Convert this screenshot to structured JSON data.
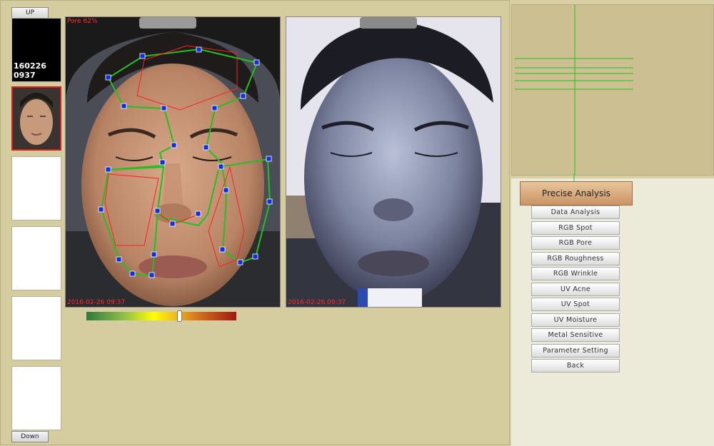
{
  "thumbnails": {
    "up_label": "UP",
    "down_label": "Down",
    "first_id_line1": "160226",
    "first_id_line2": "0937"
  },
  "photos": {
    "left_overlay_label": "Pore 62%",
    "left_timestamp": "2016-02-26 09:37",
    "right_timestamp": "2016-02-26 09:37"
  },
  "pore_scale": {
    "level": 0.62,
    "colors": [
      "#2f7a3c",
      "#ffff00",
      "#a01810"
    ]
  },
  "menu": {
    "header": "Precise Analysis",
    "items": [
      "Data Analysis",
      "RGB Spot",
      "RGB Pore",
      "RGB Roughness",
      "RGB Wrinkle",
      "UV Acne",
      "UV Spot",
      "UV Moisture",
      "Metal Sensitive",
      "Parameter Setting",
      "Back"
    ]
  },
  "colors": {
    "panel_bg": "#d5cca0",
    "accent_green": "#22c022",
    "overlay_red": "#ff2020",
    "header_button": "#d7ad80"
  }
}
